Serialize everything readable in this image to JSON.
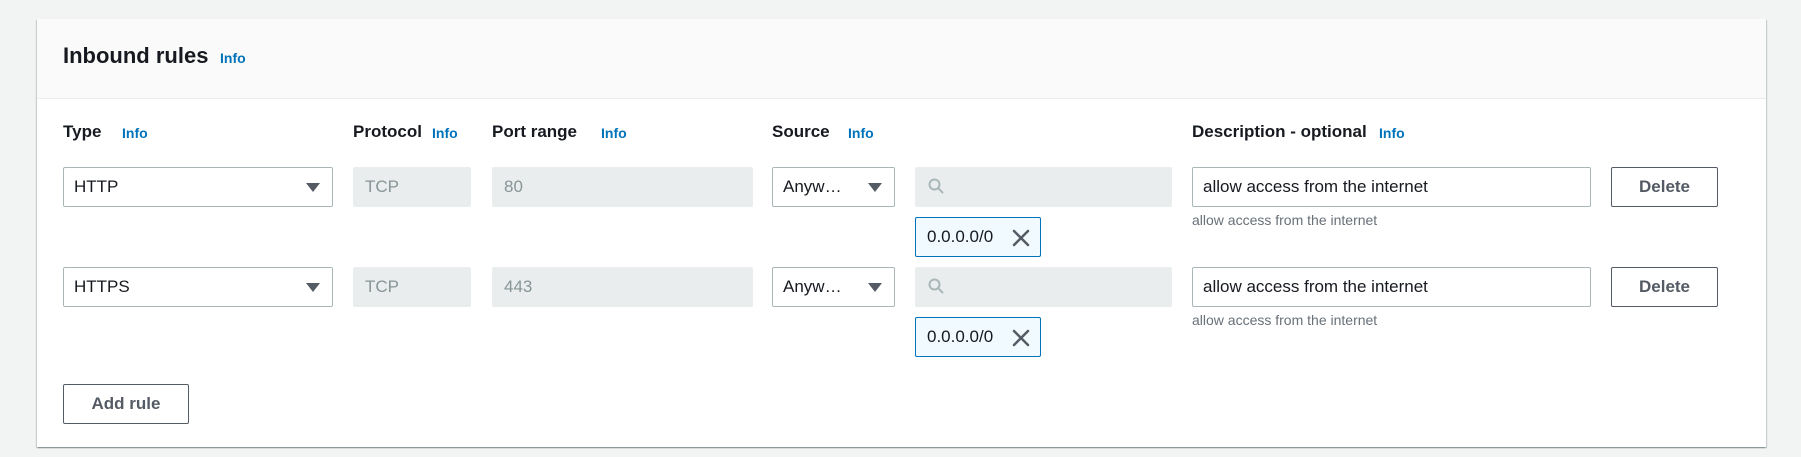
{
  "header": {
    "title": "Inbound rules",
    "info": "Info"
  },
  "columns": {
    "type": "Type",
    "protocol": "Protocol",
    "port_range": "Port range",
    "source": "Source",
    "description": "Description - optional",
    "info": "Info"
  },
  "rules": [
    {
      "type": "HTTP",
      "protocol": "TCP",
      "port_range": "80",
      "source": "Anyw…",
      "cidr": "0.0.0.0/0",
      "description": "allow access from the internet",
      "description_hint": "allow access from the internet",
      "delete_label": "Delete"
    },
    {
      "type": "HTTPS",
      "protocol": "TCP",
      "port_range": "443",
      "source": "Anyw…",
      "cidr": "0.0.0.0/0",
      "description": "allow access from the internet",
      "description_hint": "allow access from the internet",
      "delete_label": "Delete"
    }
  ],
  "add_rule_label": "Add rule",
  "colors": {
    "link": "#0073bb",
    "token_border": "#0073bb",
    "disabled_bg": "#eaeded"
  }
}
